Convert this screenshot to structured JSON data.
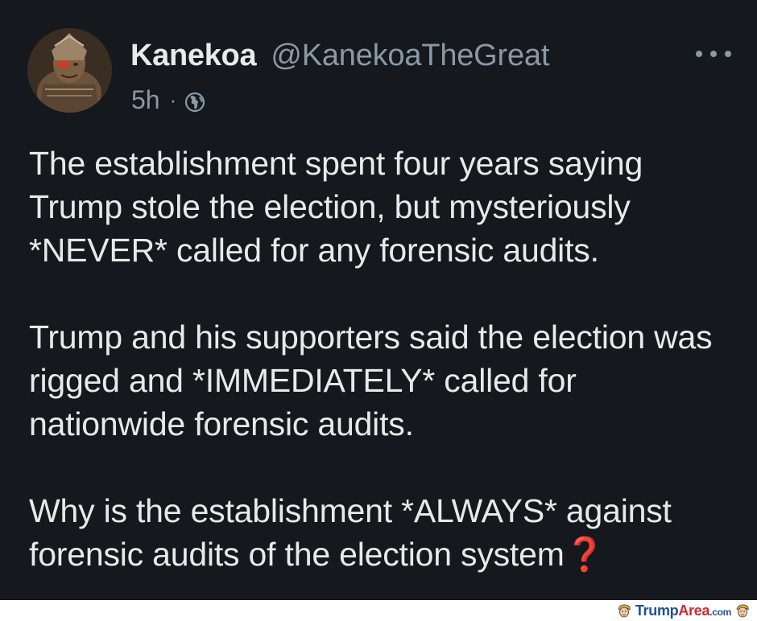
{
  "tweet": {
    "author": {
      "display_name": "Kanekoa",
      "handle": "@KanekoaTheGreat",
      "avatar_icon": "warrior-avatar"
    },
    "meta": {
      "time": "5h",
      "separator": "·",
      "visibility_icon": "globe-icon"
    },
    "more_icon": "more-horizontal-icon",
    "paragraphs": [
      "The establishment spent four years saying Trump stole the election, but mysteriously *NEVER* called for any forensic audits.",
      "Trump and his supporters said the election was rigged and *IMMEDIATELY* called for nationwide forensic audits.",
      "Why is the establishment *ALWAYS* against forensic audits of the election system"
    ],
    "trailing_emoji": "❓"
  },
  "watermark": {
    "brand_part1": "Trump",
    "brand_part2": "Area",
    "brand_suffix": ".com",
    "logo_icon": "trump-face-icon"
  },
  "colors": {
    "background": "#15181c",
    "primary_text": "#e7e9ea",
    "secondary_text": "#8b98a5",
    "question_mark": "#d9252d",
    "watermark_blue": "#1d4f9b",
    "watermark_red": "#d6262e"
  }
}
